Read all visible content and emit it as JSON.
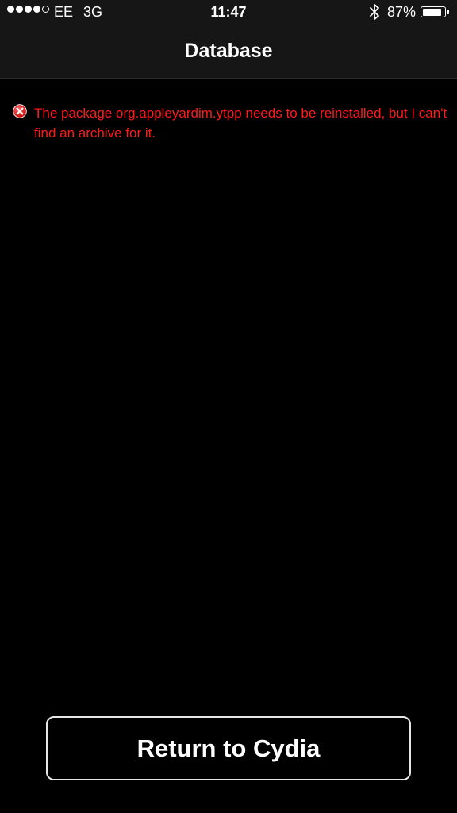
{
  "status_bar": {
    "signal_bars_filled": 4,
    "signal_bars_total": 5,
    "carrier": "EE",
    "network": "3G",
    "time": "11:47",
    "bluetooth_icon": "bluetooth-icon",
    "battery_percent": "87%",
    "battery_level": 0.87
  },
  "nav": {
    "title": "Database"
  },
  "error": {
    "icon": "error-x-icon",
    "color": "#ff1a1a",
    "message": "The package org.appleyardim.ytpp needs to be reinstalled, but I can't find an archive for it."
  },
  "footer": {
    "return_button_label": "Return to Cydia"
  }
}
